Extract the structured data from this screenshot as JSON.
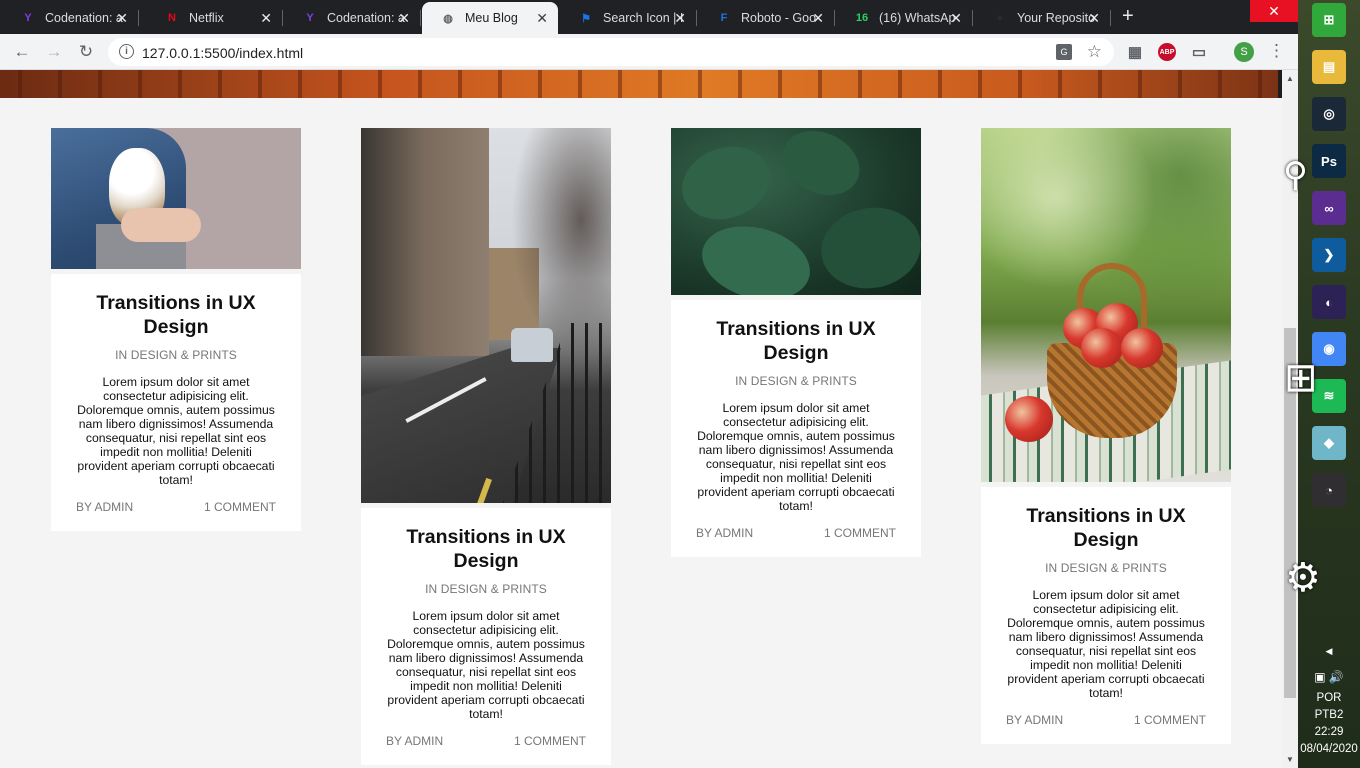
{
  "browser": {
    "tabs": [
      {
        "title": "Codenation: a",
        "icon": "codenation-icon",
        "color": "#7b3fe4",
        "glyph": "Y",
        "active": false
      },
      {
        "title": "Netflix",
        "icon": "netflix-icon",
        "color": "#e50914",
        "glyph": "N",
        "active": false
      },
      {
        "title": "Codenation: a",
        "icon": "codenation-icon",
        "color": "#7b3fe4",
        "glyph": "Y",
        "active": false
      },
      {
        "title": "Meu Blog",
        "icon": "globe-icon",
        "color": "#5f6368",
        "glyph": "◍",
        "active": true
      },
      {
        "title": "Search Icon | I",
        "icon": "flag-icon",
        "color": "#1a73e8",
        "glyph": "⚑",
        "active": false
      },
      {
        "title": "Roboto - Goo",
        "icon": "google-fonts-icon",
        "color": "#1a73e8",
        "glyph": "F",
        "active": false
      },
      {
        "title": "(16) WhatsAp",
        "icon": "whatsapp-icon",
        "color": "#25d366",
        "glyph": "16",
        "active": false
      },
      {
        "title": "Your Reposito",
        "icon": "github-icon",
        "color": "#2b2b2b",
        "glyph": "●",
        "active": false
      }
    ],
    "new_tab": "+",
    "close_glyph": "✕",
    "url": "127.0.0.1:5500/index.html",
    "profile_initial": "S",
    "extensions": [
      {
        "name": "extension-icon",
        "glyph": "▦",
        "color": "#5f6368"
      },
      {
        "name": "adblock-icon",
        "glyph": "ABP",
        "color": "#c70d2c"
      },
      {
        "name": "cast-icon",
        "glyph": "▭",
        "color": "#5f6368"
      }
    ]
  },
  "posts": [
    {
      "title": "Transitions in UX Design",
      "category": "IN DESIGN & PRINTS",
      "excerpt": "Lorem ipsum dolor sit amet consectetur adipisicing elit. Doloremque omnis, autem possimus nam libero dignissimos! Assumenda consequatur, nisi repellat sint eos impedit non mollitia! Deleniti provident aperiam corrupti obcaecati totam!",
      "author": "BY ADMIN",
      "comments": "1 COMMENT",
      "photo": "kitten"
    },
    {
      "title": "Transitions in UX Design",
      "category": "IN DESIGN & PRINTS",
      "excerpt": "Lorem ipsum dolor sit amet consectetur adipisicing elit. Doloremque omnis, autem possimus nam libero dignissimos! Assumenda consequatur, nisi repellat sint eos impedit non mollitia! Deleniti provident aperiam corrupti obcaecati totam!",
      "author": "BY ADMIN",
      "comments": "1 COMMENT",
      "photo": "street"
    },
    {
      "title": "Transitions in UX Design",
      "category": "IN DESIGN & PRINTS",
      "excerpt": "Lorem ipsum dolor sit amet consectetur adipisicing elit. Doloremque omnis, autem possimus nam libero dignissimos! Assumenda consequatur, nisi repellat sint eos impedit non mollitia! Deleniti provident aperiam corrupti obcaecati totam!",
      "author": "BY ADMIN",
      "comments": "1 COMMENT",
      "photo": "leaves"
    },
    {
      "title": "Transitions in UX Design",
      "category": "IN DESIGN & PRINTS",
      "excerpt": "Lorem ipsum dolor sit amet consectetur adipisicing elit. Doloremque omnis, autem possimus nam libero dignissimos! Assumenda consequatur, nisi repellat sint eos impedit non mollitia! Deleniti provident aperiam corrupti obcaecati totam!",
      "author": "BY ADMIN",
      "comments": "1 COMMENT",
      "photo": "apples"
    }
  ],
  "taskbar": {
    "apps": [
      {
        "name": "windows-start-icon",
        "glyph": "⊞",
        "color": "#31a83c"
      },
      {
        "name": "file-explorer-icon",
        "glyph": "▤",
        "color": "#e8b93a"
      },
      {
        "name": "steam-icon",
        "glyph": "◎",
        "color": "#1b2838"
      },
      {
        "name": "photoshop-icon",
        "glyph": "Ps",
        "color": "#0c2a44"
      },
      {
        "name": "visual-studio-icon",
        "glyph": "∞",
        "color": "#5c2d91"
      },
      {
        "name": "vscode-icon",
        "glyph": "❯",
        "color": "#0e5c9e"
      },
      {
        "name": "eclipse-icon",
        "glyph": "◐",
        "color": "#2c2255"
      },
      {
        "name": "chrome-icon",
        "glyph": "◉",
        "color": "#4285f4"
      },
      {
        "name": "spotify-icon",
        "glyph": "≋",
        "color": "#1db954"
      },
      {
        "name": "app-icon",
        "glyph": "◆",
        "color": "#6fb6c9"
      },
      {
        "name": "obs-icon",
        "glyph": "◔",
        "color": "#302e31"
      }
    ],
    "language": "POR",
    "layout": "PTB2",
    "time": "22:29",
    "date": "08/04/2020"
  }
}
